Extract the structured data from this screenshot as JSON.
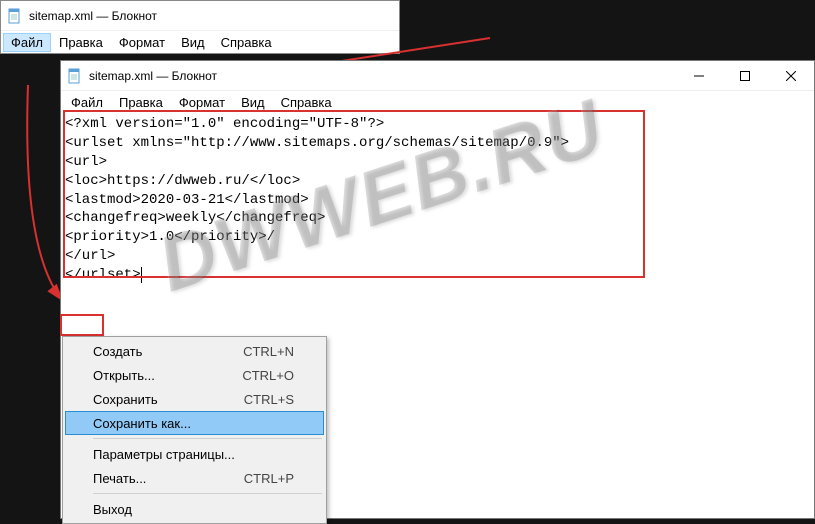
{
  "window1": {
    "title": "sitemap.xml — Блокнот",
    "menu": {
      "file": "Файл",
      "edit": "Правка",
      "format": "Формат",
      "view": "Вид",
      "help": "Справка"
    },
    "content_lines": [
      "<?xml version=\"1.0\" encoding=\"UTF-8\"?>",
      "<urlset xmlns=\"http://www.sitemaps.org/schemas/sitemap/0.9\">",
      "<url>",
      "<loc>https://dwweb.ru/</loc>",
      "<lastmod>2020-03-21</lastmod>",
      "<changefreq>weekly</changefreq>",
      "<priority>1.0</priority>/",
      "</url>",
      "</urlset>"
    ]
  },
  "window2": {
    "title": "sitemap.xml — Блокнот",
    "menu": {
      "file": "Файл",
      "edit": "Правка",
      "format": "Формат",
      "view": "Вид",
      "help": "Справка"
    },
    "dropdown": {
      "create": {
        "label": "Создать",
        "shortcut": "CTRL+N"
      },
      "open": {
        "label": "Открыть...",
        "shortcut": "CTRL+O"
      },
      "save": {
        "label": "Сохранить",
        "shortcut": "CTRL+S"
      },
      "saveas": {
        "label": "Сохранить как...",
        "shortcut": ""
      },
      "pagesetup": {
        "label": "Параметры страницы...",
        "shortcut": ""
      },
      "print": {
        "label": "Печать...",
        "shortcut": "CTRL+P"
      },
      "exit": {
        "label": "Выход",
        "shortcut": ""
      }
    }
  },
  "watermark": "DWWEB.RU"
}
